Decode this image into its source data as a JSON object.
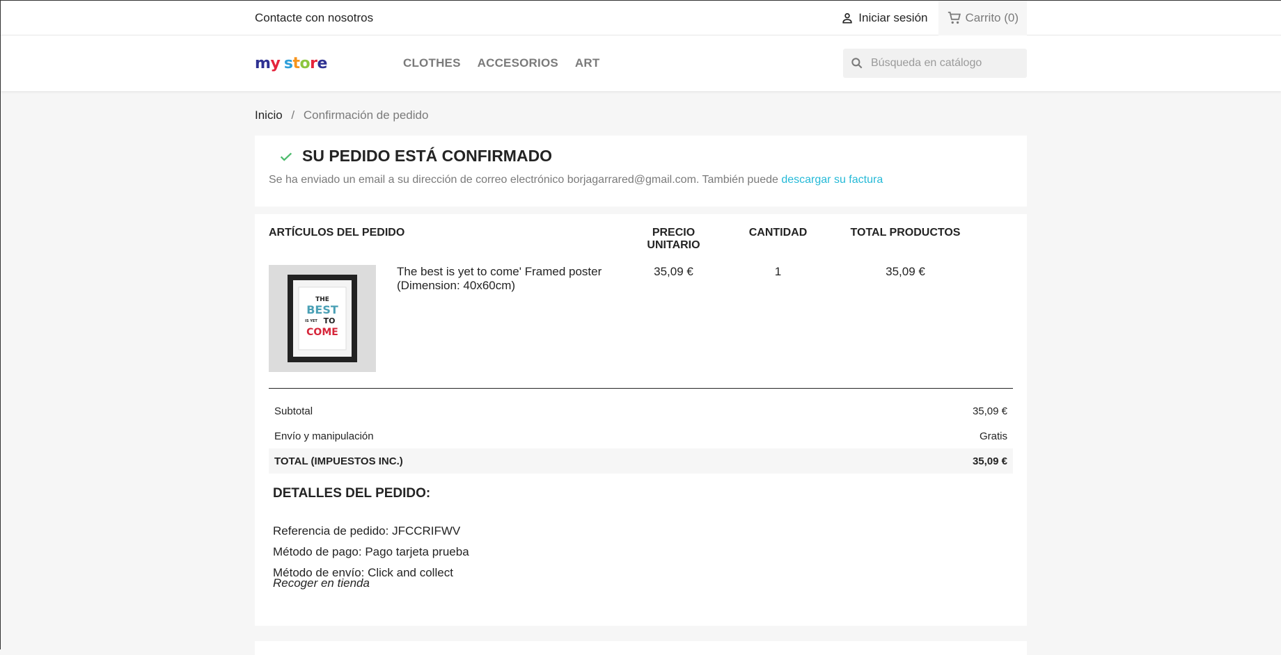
{
  "topbar": {
    "contact": "Contacte con nosotros",
    "login": "Iniciar sesión",
    "cart": "Carrito (0)"
  },
  "header": {
    "logo_text": "my store",
    "nav": [
      "CLOTHES",
      "ACCESORIOS",
      "ART"
    ],
    "search_placeholder": "Búsqueda en catálogo"
  },
  "breadcrumb": {
    "home": "Inicio",
    "separator": "/",
    "current": "Confirmación de pedido"
  },
  "confirmation": {
    "title": "SU PEDIDO ESTÁ CONFIRMADO",
    "text": "Se ha enviado un email a su dirección de correo electrónico borjagarrared@gmail.com. También puede ",
    "link": "descargar su factura"
  },
  "order": {
    "headers": {
      "items": "ARTÍCULOS DEL PEDIDO",
      "unit_price": "PRECIO UNITARIO",
      "quantity": "CANTIDAD",
      "total": "TOTAL PRODUCTOS"
    },
    "item": {
      "name": "The best is yet to come' Framed poster (Dimension: 40x60cm)",
      "unit_price": "35,09 €",
      "quantity": "1",
      "total": "35,09 €",
      "poster_lines": [
        "THE",
        "BEST",
        "IS YET",
        "TO",
        "COME"
      ]
    },
    "totals": {
      "subtotal_label": "Subtotal",
      "subtotal_value": "35,09 €",
      "shipping_label": "Envío y manipulación",
      "shipping_value": "Gratis",
      "total_label": "TOTAL (IMPUESTOS INC.)",
      "total_value": "35,09 €"
    },
    "details": {
      "title": "DETALLES DEL PEDIDO:",
      "reference": "Referencia de pedido: JFCCRIFWV",
      "payment": "Método de pago: Pago tarjeta prueba",
      "shipping": "Método de envío: Click and collect",
      "shipping_sub": "Recoger en tienda"
    }
  },
  "colors": {
    "accent": "#24b9d7",
    "check": "#4cbb6c",
    "logo": [
      "#e5243b",
      "#f7941d",
      "#2e9ed9",
      "#8cc63f"
    ]
  }
}
